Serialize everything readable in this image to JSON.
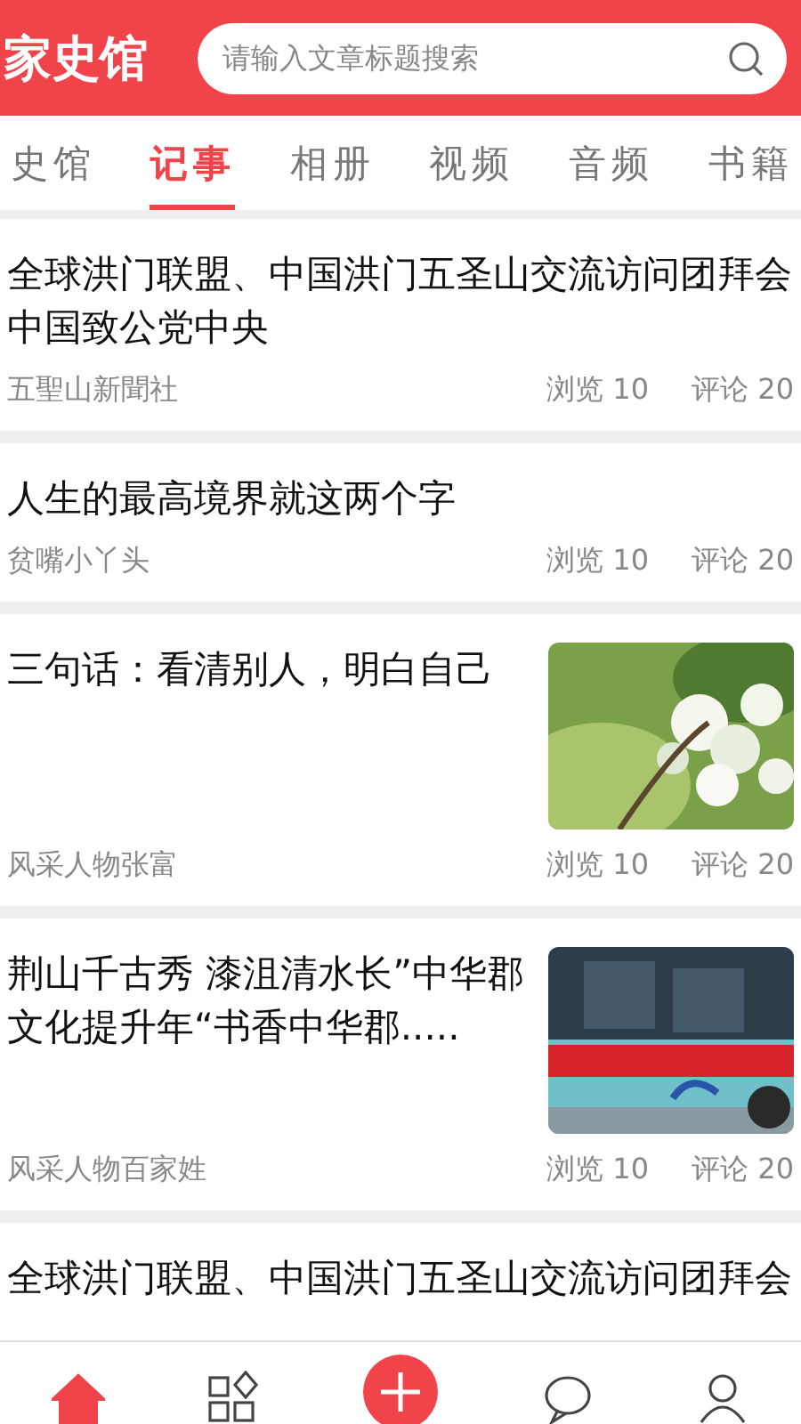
{
  "header": {
    "logo": "家史馆",
    "search": {
      "placeholder": "请输入文章标题搜索"
    }
  },
  "tabs": [
    {
      "label": "史馆",
      "selected": false
    },
    {
      "label": "记事",
      "selected": true
    },
    {
      "label": "相册",
      "selected": false
    },
    {
      "label": "视频",
      "selected": false
    },
    {
      "label": "音频",
      "selected": false
    },
    {
      "label": "书籍",
      "selected": false
    }
  ],
  "articles": [
    {
      "title": "全球洪门联盟、中国洪门五圣山交流访问团拜会中国致公党中央",
      "source": "五聖山新聞社",
      "views": "浏览  10",
      "comments": "评论 20"
    },
    {
      "title": "人生的最高境界就这两个字",
      "source": "贫嘴小丫头",
      "views": "浏览  10",
      "comments": "评论 20"
    },
    {
      "title": "三句话：看清别人，明白自己",
      "source": "风采人物张富",
      "views": "浏览  10",
      "comments": "评论 20"
    },
    {
      "title": "荆山千古秀 漆沮清水长”中华郡文化提升年“书香中华郡.....",
      "source": "风采人物百家姓",
      "views": "浏览  10",
      "comments": "评论 20"
    },
    {
      "title": "全球洪门联盟、中国洪门五圣山交流访问团拜会"
    }
  ],
  "bottom_nav": [
    {
      "kind": "home",
      "selected": true
    },
    {
      "kind": "apps",
      "selected": false
    },
    {
      "kind": "add",
      "selected": false
    },
    {
      "kind": "message",
      "selected": false
    },
    {
      "kind": "user",
      "selected": false
    }
  ]
}
